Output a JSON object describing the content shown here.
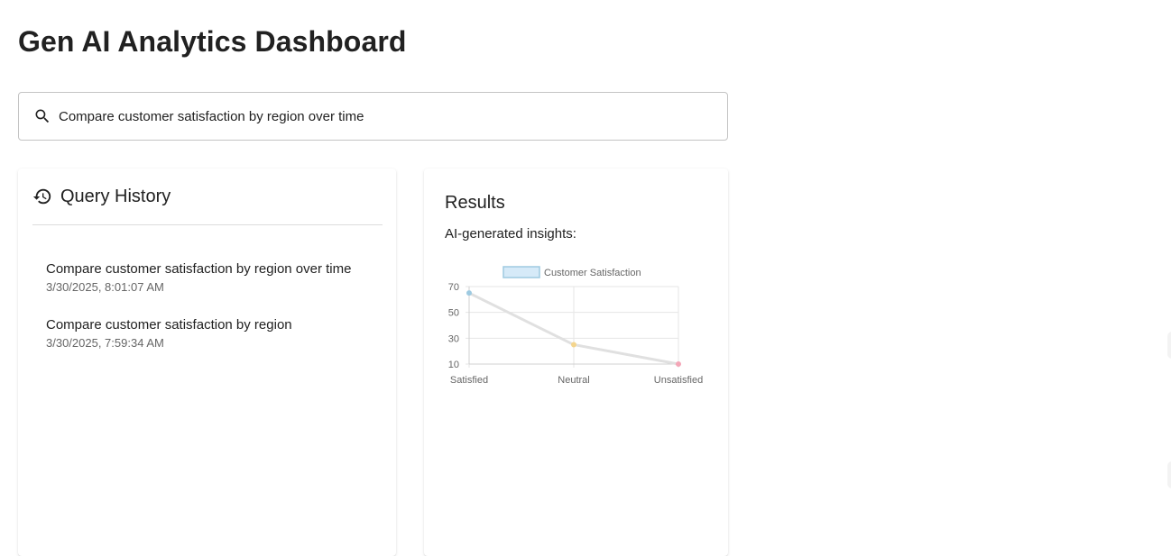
{
  "app": {
    "title": "Gen AI Analytics Dashboard"
  },
  "search": {
    "value": "Compare customer satisfaction by region over time",
    "icon": "search-icon"
  },
  "history": {
    "title": "Query History",
    "icon": "history-icon",
    "items": [
      {
        "query": "Compare customer satisfaction by region over time",
        "timestamp": "3/30/2025, 8:01:07 AM"
      },
      {
        "query": "Compare customer satisfaction by region",
        "timestamp": "3/30/2025, 7:59:34 AM"
      }
    ]
  },
  "results": {
    "title": "Results",
    "subtitle": "AI-generated insights:"
  },
  "chart_data": {
    "type": "line",
    "title": "",
    "categories": [
      "Satisfied",
      "Neutral",
      "Unsatisfied"
    ],
    "series": [
      {
        "name": "Customer Satisfaction",
        "values": [
          65,
          25,
          10
        ],
        "color": "#e0e0e0",
        "legend_fill": "#d6eaf8",
        "legend_stroke": "#9ecae1",
        "point_colors": [
          "#9ecae1",
          "#f4d58d",
          "#f4a6b7"
        ]
      }
    ],
    "yticks": [
      10,
      30,
      50,
      70
    ],
    "ylim": [
      10,
      70
    ],
    "grid": true,
    "legend": "top"
  }
}
